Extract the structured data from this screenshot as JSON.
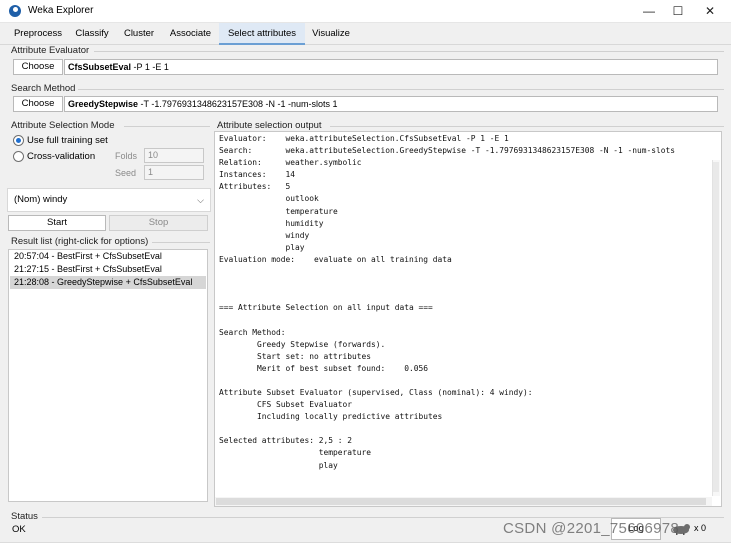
{
  "window": {
    "title": "Weka Explorer",
    "minimize": "—",
    "maximize": "☐",
    "close": "✕"
  },
  "tabs": [
    {
      "label": "Preprocess"
    },
    {
      "label": "Classify"
    },
    {
      "label": "Cluster"
    },
    {
      "label": "Associate"
    },
    {
      "label": "Select attributes",
      "active": true
    },
    {
      "label": "Visualize"
    }
  ],
  "evaluator": {
    "heading": "Attribute Evaluator",
    "choose_label": "Choose",
    "name": "CfsSubsetEval",
    "options": " -P 1 -E 1"
  },
  "search": {
    "heading": "Search Method",
    "choose_label": "Choose",
    "name": "GreedyStepwise",
    "options": " -T -1.7976931348623157E308 -N -1 -num-slots 1"
  },
  "mode": {
    "heading": "Attribute Selection Mode",
    "full_training": "Use full training set",
    "cross_validation": "Cross-validation",
    "folds_label": "Folds",
    "folds_value": "10",
    "seed_label": "Seed",
    "seed_value": "1",
    "selected": "full_training"
  },
  "class_select": {
    "value": "(Nom) windy"
  },
  "actions": {
    "start": "Start",
    "stop": "Stop"
  },
  "results": {
    "heading": "Result list (right-click for options)",
    "items": [
      {
        "label": "20:57:04 - BestFirst + CfsSubsetEval"
      },
      {
        "label": "21:27:15 - BestFirst + CfsSubsetEval"
      },
      {
        "label": "21:28:08 - GreedyStepwise + CfsSubsetEval",
        "selected": true
      }
    ]
  },
  "output": {
    "heading": "Attribute selection output",
    "lines": [
      "Evaluator:    weka.attributeSelection.CfsSubsetEval -P 1 -E 1",
      "Search:       weka.attributeSelection.GreedyStepwise -T -1.7976931348623157E308 -N -1 -num-slots",
      "Relation:     weather.symbolic",
      "Instances:    14",
      "Attributes:   5",
      "              outlook",
      "              temperature",
      "              humidity",
      "              windy",
      "              play",
      "Evaluation mode:    evaluate on all training data",
      "",
      "",
      "",
      "=== Attribute Selection on all input data ===",
      "",
      "Search Method:",
      "        Greedy Stepwise (forwards).",
      "        Start set: no attributes",
      "        Merit of best subset found:    0.056",
      "",
      "Attribute Subset Evaluator (supervised, Class (nominal): 4 windy):",
      "        CFS Subset Evaluator",
      "        Including locally predictive attributes",
      "",
      "Selected attributes: 2,5 : 2",
      "                     temperature",
      "                     play"
    ]
  },
  "status": {
    "heading": "Status",
    "text": "OK",
    "log_label": "Log",
    "x_count": "x 0"
  },
  "watermark": "CSDN @2201_75606978",
  "colors": {
    "active_tab": "#dfe9f5",
    "selected_row": "#d6d6d6",
    "radio_accent": "#1f6fd0"
  }
}
